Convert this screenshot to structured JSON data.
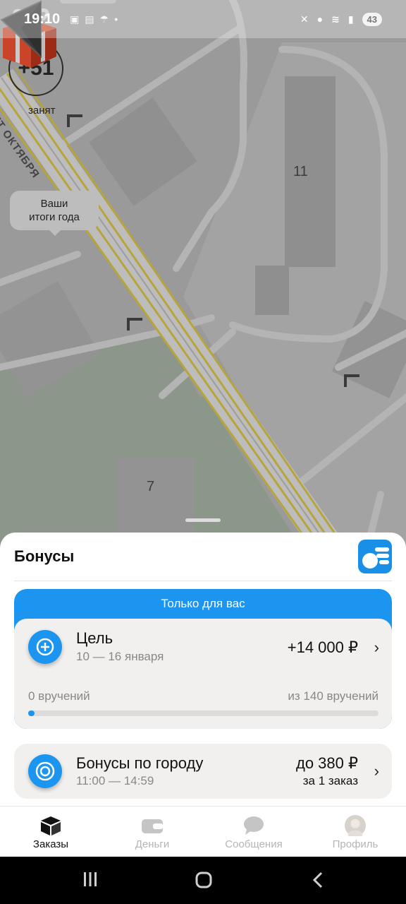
{
  "status_bar": {
    "time": "19:10",
    "battery": "43"
  },
  "map": {
    "rating": "+51",
    "driver_status": "занят",
    "street_name": "ЛЕТ ОКТЯБРЯ",
    "building_11": "11",
    "building_7": "7",
    "year_results_line1": "Ваши",
    "year_results_line2": "итоги года"
  },
  "sheet": {
    "title": "Бонусы",
    "goal_card": {
      "banner": "Только для вас",
      "title": "Цель",
      "dates": "10 — 16 января",
      "amount": "+14 000 ₽",
      "progress_done_label": "0 вручений",
      "progress_total_label": "из 140 вручений",
      "progress_done": 0,
      "progress_total": 140
    },
    "city_card": {
      "title": "Бонусы по городу",
      "time": "11:00 — 14:59",
      "amount": "до 380 ₽",
      "per_order": "за 1 заказ"
    }
  },
  "tabs": [
    {
      "label": "Заказы",
      "icon": "orders-cube-icon",
      "active": true
    },
    {
      "label": "Деньги",
      "icon": "wallet-icon",
      "active": false
    },
    {
      "label": "Сообщения",
      "icon": "chat-bubble-icon",
      "active": false
    },
    {
      "label": "Профиль",
      "icon": "avatar",
      "active": false
    }
  ],
  "colors": {
    "accent": "#1b95f0",
    "road_yellow": "#b7a43a",
    "map_bg": "#9a9a9a"
  }
}
